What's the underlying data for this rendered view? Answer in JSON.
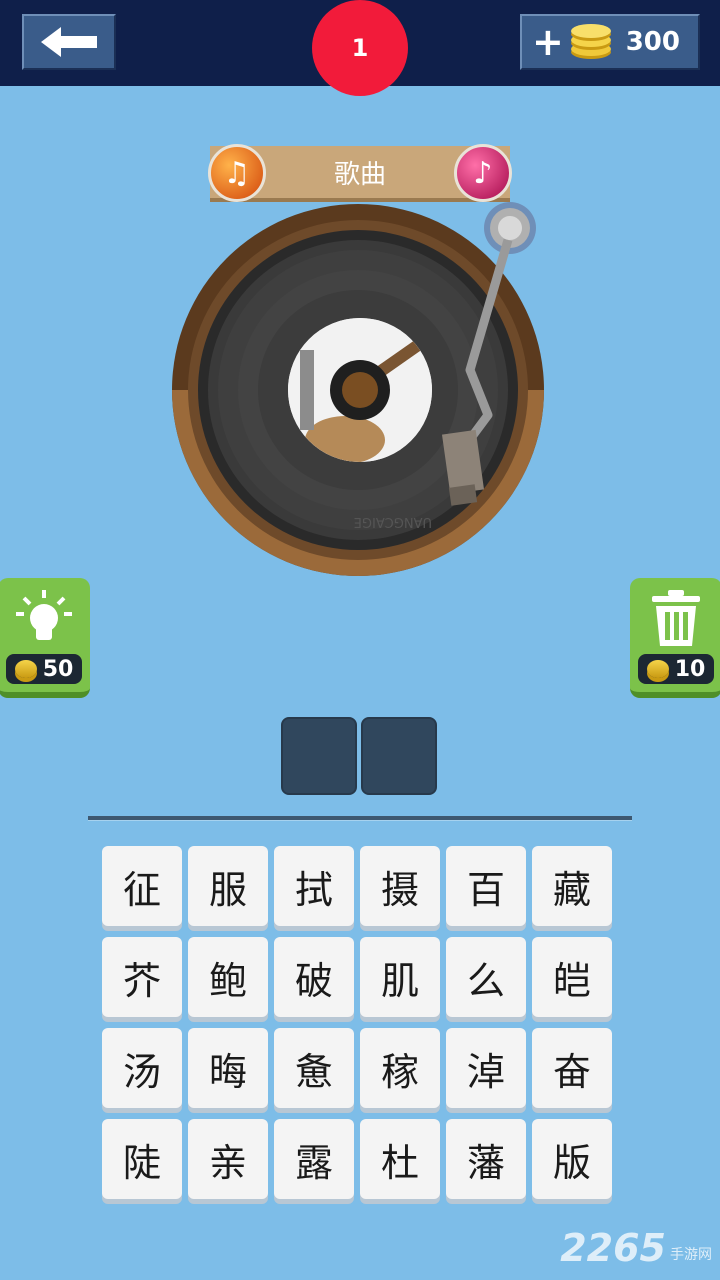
{
  "header": {
    "level": "1",
    "coins": "300"
  },
  "category": {
    "label": "歌曲"
  },
  "record": {
    "label_text": "UANGCAIGE"
  },
  "hint_button": {
    "cost": "50"
  },
  "delete_button": {
    "cost": "10"
  },
  "answer": {
    "slots": [
      "",
      ""
    ]
  },
  "letters": [
    [
      "征",
      "服",
      "拭",
      "摄",
      "百",
      "藏"
    ],
    [
      "芥",
      "鲍",
      "破",
      "肌",
      "么",
      "皑"
    ],
    [
      "汤",
      "晦",
      "惫",
      "稼",
      "淖",
      "奋"
    ],
    [
      "陡",
      "亲",
      "露",
      "杜",
      "藩",
      "版"
    ]
  ],
  "watermark": {
    "number": "2265",
    "text": "手游网"
  },
  "colors": {
    "background": "#7dbde8",
    "topbar": "#0f1f4a",
    "level_badge": "#f21b3a",
    "side_button": "#7cc24a",
    "answer_slot": "#30475d"
  }
}
